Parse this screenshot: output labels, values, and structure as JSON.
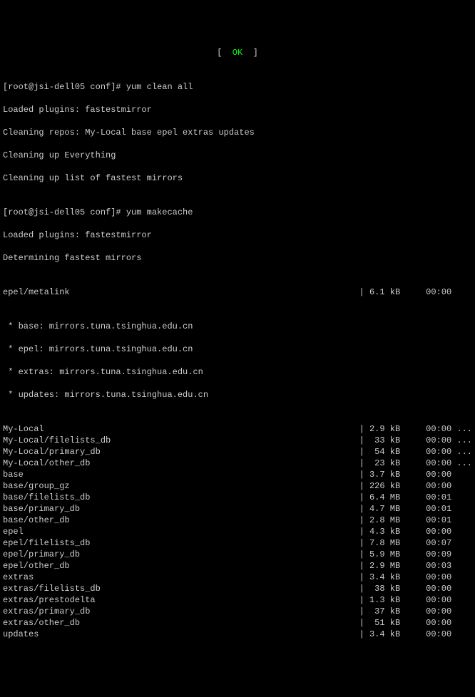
{
  "top_status": {
    "lbracket": "[  ",
    "ok": "OK",
    "rbracket": "  ]"
  },
  "prompt1": {
    "prompt": "[root@jsi-dell05 conf]#",
    "cmd": "yum clean all"
  },
  "lines1": [
    "Loaded plugins: fastestmirror",
    "Cleaning repos: My-Local base epel extras updates",
    "Cleaning up Everything",
    "Cleaning up list of fastest mirrors"
  ],
  "prompt2": {
    "prompt": "[root@jsi-dell05 conf]#",
    "cmd": "yum makecache"
  },
  "lines2": [
    "Loaded plugins: fastestmirror",
    "Determining fastest mirrors"
  ],
  "meta_row": {
    "name": "epel/metalink",
    "size": "| 6.1 kB",
    "time": "00:00"
  },
  "mirror_lines": [
    " * base: mirrors.tuna.tsinghua.edu.cn",
    " * epel: mirrors.tuna.tsinghua.edu.cn",
    " * extras: mirrors.tuna.tsinghua.edu.cn",
    " * updates: mirrors.tuna.tsinghua.edu.cn"
  ],
  "rows": [
    {
      "name": "My-Local",
      "size": "| 2.9 kB",
      "time": "00:00 ..."
    },
    {
      "name": "My-Local/filelists_db",
      "size": "|  33 kB",
      "time": "00:00 ..."
    },
    {
      "name": "My-Local/primary_db",
      "size": "|  54 kB",
      "time": "00:00 ..."
    },
    {
      "name": "My-Local/other_db",
      "size": "|  23 kB",
      "time": "00:00 ..."
    },
    {
      "name": "base",
      "size": "| 3.7 kB",
      "time": "00:00    "
    },
    {
      "name": "base/group_gz",
      "size": "| 226 kB",
      "time": "00:00    "
    },
    {
      "name": "base/filelists_db",
      "size": "| 6.4 MB",
      "time": "00:01    "
    },
    {
      "name": "base/primary_db",
      "size": "| 4.7 MB",
      "time": "00:01    "
    },
    {
      "name": "base/other_db",
      "size": "| 2.8 MB",
      "time": "00:01    "
    },
    {
      "name": "epel",
      "size": "| 4.3 kB",
      "time": "00:00    "
    },
    {
      "name": "epel/filelists_db",
      "size": "| 7.8 MB",
      "time": "00:07    "
    },
    {
      "name": "epel/primary_db",
      "size": "| 5.9 MB",
      "time": "00:09    "
    },
    {
      "name": "epel/other_db",
      "size": "| 2.9 MB",
      "time": "00:03    "
    },
    {
      "name": "extras",
      "size": "| 3.4 kB",
      "time": "00:00    "
    },
    {
      "name": "extras/filelists_db",
      "size": "|  38 kB",
      "time": "00:00    "
    },
    {
      "name": "extras/prestodelta",
      "size": "| 1.3 kB",
      "time": "00:00    "
    },
    {
      "name": "extras/primary_db",
      "size": "|  37 kB",
      "time": "00:00    "
    },
    {
      "name": "extras/other_db",
      "size": "|  51 kB",
      "time": "00:00    "
    },
    {
      "name": "updates",
      "size": "| 3.4 kB",
      "time": "00:00    "
    }
  ]
}
